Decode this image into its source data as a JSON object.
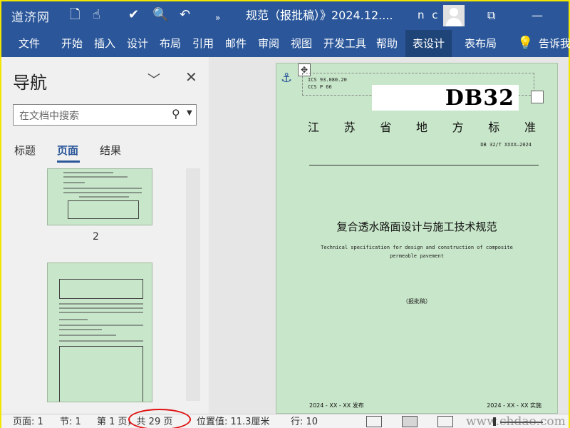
{
  "titlebar": {
    "logo": "道济网",
    "doc_title": "规范（报批稿）》2024.12....",
    "user": "n c",
    "colors": {
      "bar": "#2b579a"
    }
  },
  "ribbon": {
    "tabs": [
      "文件",
      "开始",
      "插入",
      "设计",
      "布局",
      "引用",
      "邮件",
      "审阅",
      "视图",
      "开发工具",
      "帮助",
      "表设计",
      "表布局"
    ],
    "tell_me": "告诉我"
  },
  "nav": {
    "title": "导航",
    "search_placeholder": "在文档中搜索",
    "tabs": [
      "标题",
      "页面",
      "结果"
    ],
    "active_tab": "页面",
    "page_label": "2"
  },
  "document": {
    "ics": "ICS  93.080.20",
    "ccs": "CCS P 66",
    "db_mark": "DB32",
    "province": [
      "江",
      "苏",
      "省",
      "地",
      "方",
      "标",
      "准"
    ],
    "std_number": "DB 32/T XXXX—2024",
    "title_cn": "复合透水路面设计与施工技术规范",
    "title_en_1": "Technical specification for design and construction of composite",
    "title_en_2": "permeable pavement",
    "draft": "（报批稿）",
    "publish": "2024 - XX - XX 发布",
    "implement": "2024 - XX - XX 实施",
    "page_color": "#c8e6c9"
  },
  "status": {
    "page": "页面: 1",
    "section": "节: 1",
    "page_of": "第 1 页，共 29 页",
    "position": "位置值: 11.3厘米",
    "line": "行: 10",
    "watermark": "www.chdao.com"
  }
}
